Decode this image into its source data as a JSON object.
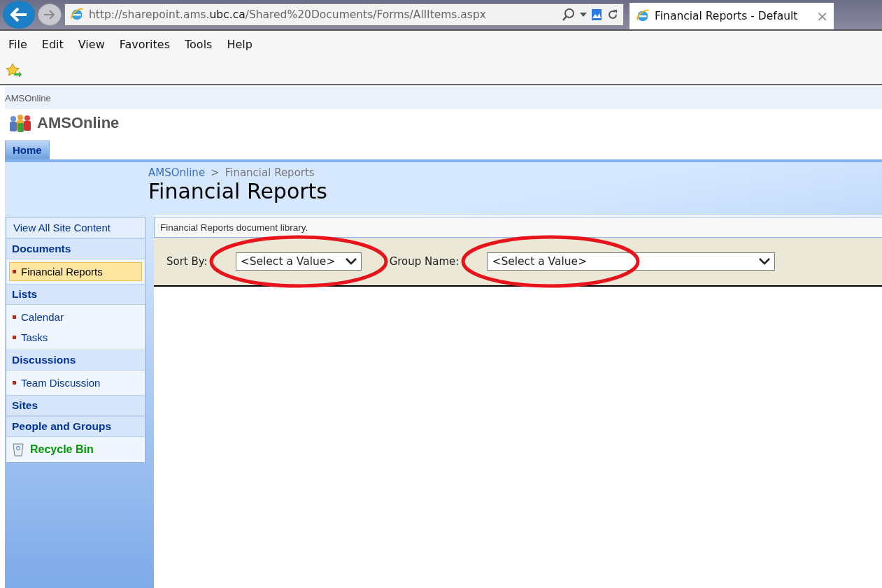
{
  "browser": {
    "address": {
      "prefix": "http://sharepoint.ams.",
      "host": "ubc.ca",
      "path": "/Shared%20Documents/Forms/AllItems.aspx"
    },
    "tab": {
      "title": "Financial Reports - Default",
      "close": "×"
    },
    "menu": [
      "File",
      "Edit",
      "View",
      "Favorites",
      "Tools",
      "Help"
    ]
  },
  "site": {
    "top_link": "AMSOnline",
    "title": "AMSOnline",
    "tabs": [
      {
        "label": "Home",
        "selected": true
      }
    ]
  },
  "breadcrumb": {
    "parent": "AMSOnline",
    "separator": ">",
    "current": "Financial Reports"
  },
  "page_title": "Financial Reports",
  "sidebar": {
    "view_all": "View All Site Content",
    "sections": [
      {
        "title": "Documents",
        "items": [
          {
            "label": "Financial Reports",
            "selected": true
          }
        ]
      },
      {
        "title": "Lists",
        "items": [
          {
            "label": "Calendar",
            "selected": false
          },
          {
            "label": "Tasks",
            "selected": false
          }
        ]
      },
      {
        "title": "Discussions",
        "items": [
          {
            "label": "Team Discussion",
            "selected": false
          }
        ]
      },
      {
        "title": "Sites"
      },
      {
        "title": "People and Groups"
      }
    ],
    "recycle_bin": "Recycle Bin"
  },
  "description": "Financial Reports document library.",
  "filters": [
    {
      "label": "Sort By:",
      "value": "<Select a Value>",
      "wide": false,
      "circled": true
    },
    {
      "label": "Group Name:",
      "value": "<Select a Value>",
      "wide": true,
      "circled": true
    }
  ]
}
